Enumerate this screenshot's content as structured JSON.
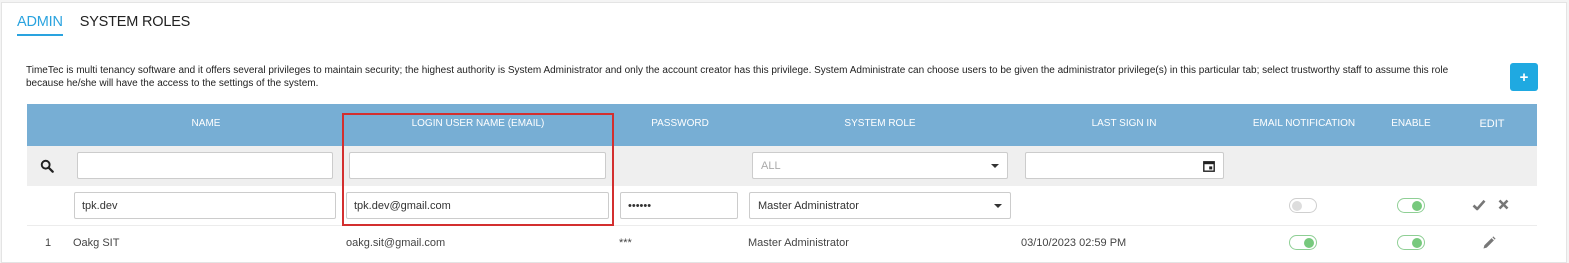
{
  "tabs": [
    {
      "label": "ADMIN",
      "active": true
    },
    {
      "label": "SYSTEM ROLES",
      "active": false
    }
  ],
  "description": "TimeTec is multi tenancy software and it offers several privileges to maintain security; the highest authority is System Administrator and only the account creator has this privilege. System Administrate can choose users to be given the administrator privilege(s) in this particular tab; select trustworthy staff to assume this role because he/she will have the access to the settings of the system.",
  "add_button": "+",
  "columns": {
    "name": "NAME",
    "login": "LOGIN USER NAME (EMAIL)",
    "password": "PASSWORD",
    "role": "SYSTEM ROLE",
    "last_sign_in": "LAST SIGN IN",
    "email_notification": "EMAIL NOTIFICATION",
    "enable": "ENABLE",
    "edit": "EDIT"
  },
  "filters": {
    "name": "",
    "login": "",
    "role_selected": "ALL",
    "last_sign_in": ""
  },
  "edit_row": {
    "name": "tpk.dev",
    "login": "tpk.dev@gmail.com",
    "password": "••••••",
    "role": "Master Administrator",
    "email_notification": false,
    "enable": true
  },
  "rows": [
    {
      "index": "1",
      "name": "Oakg SIT",
      "login": "oakg.sit@gmail.com",
      "password": "***",
      "role": "Master Administrator",
      "last_sign_in": "03/10/2023 02:59 PM",
      "email_notification": true,
      "enable": true
    }
  ],
  "colors": {
    "accent": "#2aa3df",
    "header": "#77aed4",
    "toggle_on": "#77c97d",
    "highlight": "#d32f2f"
  }
}
